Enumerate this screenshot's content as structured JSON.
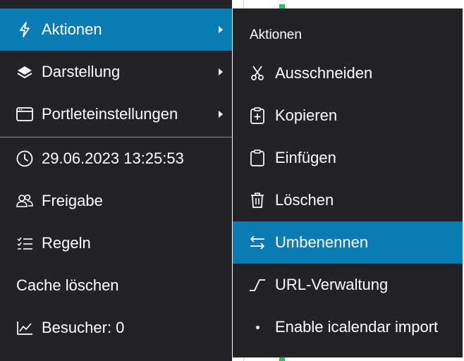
{
  "left_menu": {
    "items": [
      {
        "label": "Aktionen",
        "icon": "lightning-icon",
        "has_submenu": true,
        "active": true
      },
      {
        "label": "Darstellung",
        "icon": "layers-icon",
        "has_submenu": true,
        "active": false
      },
      {
        "label": "Portleteinstellungen",
        "icon": "window-icon",
        "has_submenu": true,
        "active": false
      }
    ],
    "info_items": [
      {
        "label": "29.06.2023 13:25:53",
        "icon": "clock-icon"
      },
      {
        "label": "Freigabe",
        "icon": "users-icon"
      },
      {
        "label": "Regeln",
        "icon": "checklist-icon"
      },
      {
        "label": "Cache löschen",
        "icon": ""
      },
      {
        "label": "Besucher: 0",
        "icon": "line-chart-icon"
      }
    ]
  },
  "submenu": {
    "header": "Aktionen",
    "items": [
      {
        "label": "Ausschneiden",
        "icon": "scissors-icon",
        "active": false
      },
      {
        "label": "Kopieren",
        "icon": "clipboard-plus-icon",
        "active": false
      },
      {
        "label": "Einfügen",
        "icon": "clipboard-icon",
        "active": false
      },
      {
        "label": "Löschen",
        "icon": "trash-icon",
        "active": false
      },
      {
        "label": "Umbenennen",
        "icon": "swap-arrows-icon",
        "active": true
      },
      {
        "label": "URL-Verwaltung",
        "icon": "slug-icon",
        "active": false
      },
      {
        "label": "Enable icalendar import",
        "icon": "dot-icon",
        "active": false
      }
    ]
  },
  "colors": {
    "menu_bg": "#212327",
    "active_bg": "#0b7bb3",
    "text": "#ffffff",
    "divider": "#8a8a8a"
  }
}
